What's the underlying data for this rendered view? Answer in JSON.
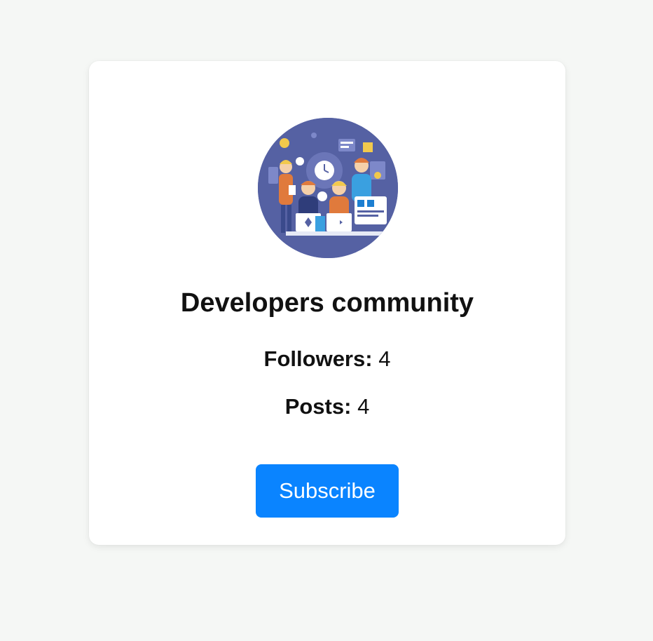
{
  "community": {
    "name": "Developers community",
    "avatar_icon": "developers-team-illustration",
    "followers_label": "Followers:",
    "followers_count": "4",
    "posts_label": "Posts:",
    "posts_count": "4"
  },
  "actions": {
    "subscribe_label": "Subscribe"
  },
  "colors": {
    "background": "#f5f7f5",
    "card": "#ffffff",
    "accent": "#0a84ff",
    "avatar_bg": "#5561a3"
  }
}
